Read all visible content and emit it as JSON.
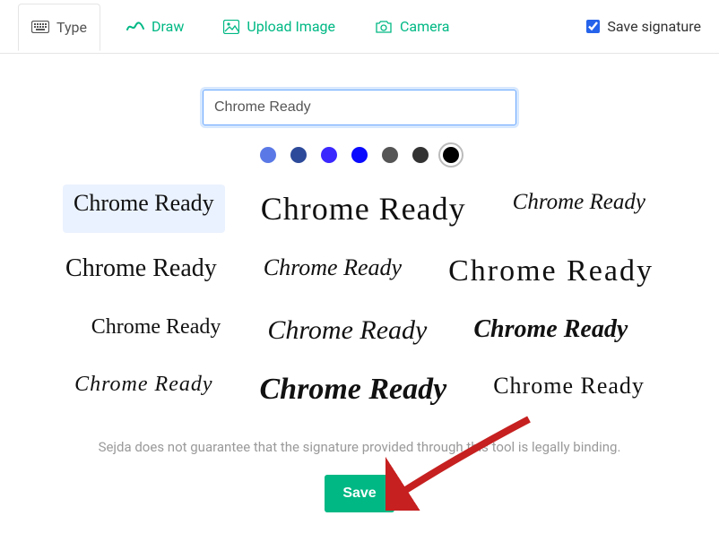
{
  "tabs": {
    "type": "Type",
    "draw": "Draw",
    "upload": "Upload Image",
    "camera": "Camera"
  },
  "saveSignature": {
    "label": "Save signature",
    "checked": true
  },
  "input": {
    "value": "Chrome Ready"
  },
  "colors": [
    {
      "hex": "#5b79e6",
      "selected": false
    },
    {
      "hex": "#2d4a9a",
      "selected": false
    },
    {
      "hex": "#3b28ff",
      "selected": false
    },
    {
      "hex": "#0a0aff",
      "selected": false
    },
    {
      "hex": "#555555",
      "selected": false
    },
    {
      "hex": "#333333",
      "selected": false
    },
    {
      "hex": "#000000",
      "selected": true
    }
  ],
  "fontOptions": [
    {
      "text": "Chrome Ready",
      "selected": true
    },
    {
      "text": "Chrome Ready",
      "selected": false
    },
    {
      "text": "Chrome Ready",
      "selected": false
    },
    {
      "text": "Chrome Ready",
      "selected": false
    },
    {
      "text": "Chrome Ready",
      "selected": false
    },
    {
      "text": "Chrome Ready",
      "selected": false
    },
    {
      "text": "Chrome Ready",
      "selected": false
    },
    {
      "text": "Chrome Ready",
      "selected": false
    },
    {
      "text": "Chrome Ready",
      "selected": false
    },
    {
      "text": "Chrome Ready",
      "selected": false
    },
    {
      "text": "Chrome Ready",
      "selected": false
    },
    {
      "text": "Chrome Ready",
      "selected": false
    }
  ],
  "disclaimer": "Sejda does not guarantee that the signature provided through this tool is legally binding.",
  "saveButton": "Save"
}
